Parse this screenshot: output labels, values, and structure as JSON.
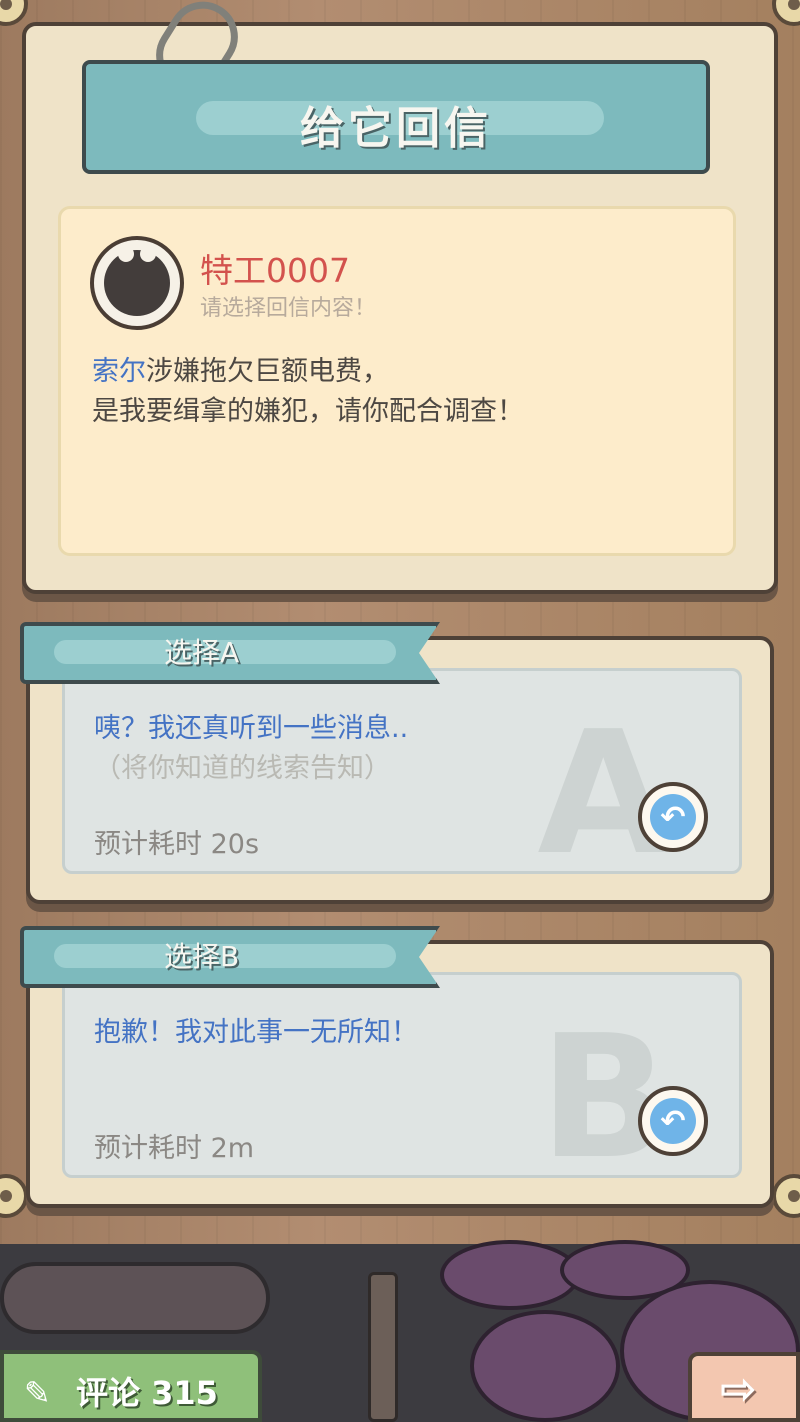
{
  "header": {
    "title": "给它回信"
  },
  "letter": {
    "sender": "特工0007",
    "hint": "请选择回信内容！",
    "message_name": "索尔",
    "message_line1_rest": "涉嫌拖欠巨额电费，",
    "message_line2": "是我要缉拿的嫌犯，请你配合调查！"
  },
  "choices": [
    {
      "label": "选择A",
      "letter": "A",
      "text": "咦？我还真听到一些消息..",
      "sub": "（将你知道的线索告知）",
      "time": "预计耗时  20s"
    },
    {
      "label": "选择B",
      "letter": "B",
      "text": "抱歉！我对此事一无所知！",
      "sub": "",
      "time": "预计耗时  2m"
    }
  ],
  "footer": {
    "comment_label": "评论 315"
  },
  "icons": {
    "reply": "reply-arrow-icon",
    "feather": "feather-pen-icon",
    "next": "right-arrow-icon"
  },
  "colors": {
    "accent_teal": "#7dbabd",
    "sender_red": "#d3524d",
    "link_blue": "#4473c4"
  }
}
